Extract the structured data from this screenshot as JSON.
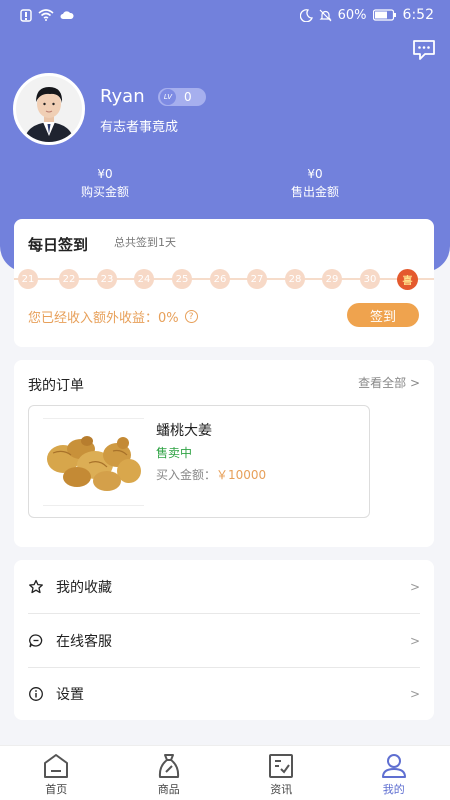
{
  "status_bar": {
    "battery": "60%",
    "time": "6:52"
  },
  "user": {
    "name": "Ryan",
    "level_prefix": "LV",
    "level": "0",
    "motto": "有志者事竟成"
  },
  "stats": {
    "buy": {
      "value": "¥0",
      "label": "购买金额"
    },
    "sell": {
      "value": "¥0",
      "label": "售出金额"
    }
  },
  "checkin": {
    "title": "每日签到",
    "subtitle": "总共签到1天",
    "days": [
      "21",
      "22",
      "23",
      "24",
      "25",
      "26",
      "27",
      "28",
      "29",
      "30"
    ],
    "gift_label": "喜",
    "income_text": "您已经收入额外收益：0%",
    "button_label": "签到"
  },
  "orders": {
    "title": "我的订单",
    "view_all": "查看全部 >",
    "item": {
      "name": "蟠桃大姜",
      "status": "售卖中",
      "amount_label": "买入金额：",
      "amount_value": "￥10000"
    }
  },
  "menu": [
    {
      "label": "我的收藏",
      "icon": "star-icon",
      "arrow": ">"
    },
    {
      "label": "在线客服",
      "icon": "chat-icon",
      "arrow": ">"
    },
    {
      "label": "设置",
      "icon": "info-icon",
      "arrow": ">"
    }
  ],
  "nav": [
    {
      "label": "首页",
      "icon": "home-icon",
      "active": false
    },
    {
      "label": "商品",
      "icon": "bag-icon",
      "active": false
    },
    {
      "label": "资讯",
      "icon": "news-icon",
      "active": false
    },
    {
      "label": "我的",
      "icon": "user-icon",
      "active": true
    }
  ],
  "colors": {
    "brand": "#7281dc",
    "accent_orange": "#efa34e",
    "status_green": "#2fa344",
    "active_nav": "#5f6fd1"
  }
}
